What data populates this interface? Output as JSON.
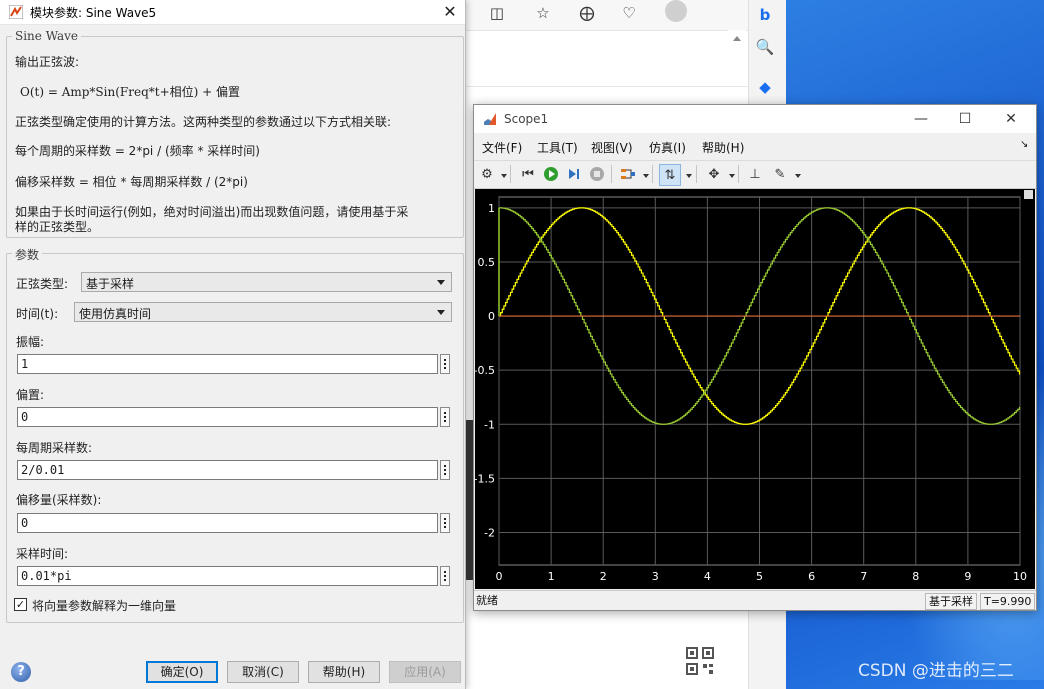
{
  "dialog": {
    "title": "模块参数: Sine Wave5",
    "block_group_title": "Sine Wave",
    "desc_lines": [
      "输出正弦波:",
      "O(t) = Amp*Sin(Freq*t+相位) + 偏置",
      "正弦类型确定使用的计算方法。这两种类型的参数通过以下方式相关联:",
      "每个周期的采样数 = 2*pi / (频率 * 采样时间)",
      "偏移采样数 = 相位 * 每周期采样数 / (2*pi)",
      "如果由于长时间运行(例如，绝对时间溢出)而出现数值问题，请使用基于采",
      "样的正弦类型。"
    ],
    "params_group_title": "参数",
    "sine_type_label": "正弦类型:",
    "sine_type_value": "基于采样",
    "time_label": "时间(t):",
    "time_value": "使用仿真时间",
    "amplitude_label": "振幅:",
    "amplitude_value": "1",
    "bias_label": "偏置:",
    "bias_value": "0",
    "samples_label": "每周期采样数:",
    "samples_value": "2/0.01",
    "offset_label": "偏移量(采样数):",
    "offset_value": "0",
    "sample_time_label": "采样时间:",
    "sample_time_value": "0.01*pi",
    "checkbox_label": "将向量参数解释为一维向量",
    "checkbox_checked": true,
    "buttons": {
      "ok": "确定(O)",
      "cancel": "取消(C)",
      "help": "帮助(H)",
      "apply": "应用(A)"
    },
    "help_icon_glyph": "?"
  },
  "scope": {
    "title": "Scope1",
    "menus": [
      "文件(F)",
      "工具(T)",
      "视图(V)",
      "仿真(I)",
      "帮助(H)"
    ],
    "status_left": "就绪",
    "status_mode": "基于采样",
    "status_time": "T=9.990"
  },
  "watermark": "CSDN @进击的三二",
  "colors": {
    "series_yellow": "#ffff00",
    "series_green": "#9acd32",
    "series_orange": "#e8703a",
    "plot_bg": "#000000",
    "grid": "#5a5a5a",
    "axis_text": "#ffffff"
  },
  "chart_data": {
    "type": "line",
    "title": "",
    "xlabel": "",
    "ylabel": "",
    "xlim": [
      0,
      10
    ],
    "ylim": [
      -2.3,
      1.1
    ],
    "xticks": [
      0,
      1,
      2,
      3,
      4,
      5,
      6,
      7,
      8,
      9,
      10
    ],
    "yticks": [
      1,
      0.5,
      0,
      -0.5,
      -1,
      -1.5,
      -2
    ],
    "grid": true,
    "legend": "none",
    "series": [
      {
        "color": "#ffff00",
        "function": "sin(t)",
        "sample_time": 0.0314159
      },
      {
        "color": "#9acd32",
        "function": "cos(t)",
        "sample_time": 0.0314159
      },
      {
        "color": "#e8703a",
        "function": "0",
        "sample_time": 0.0314159
      }
    ]
  }
}
